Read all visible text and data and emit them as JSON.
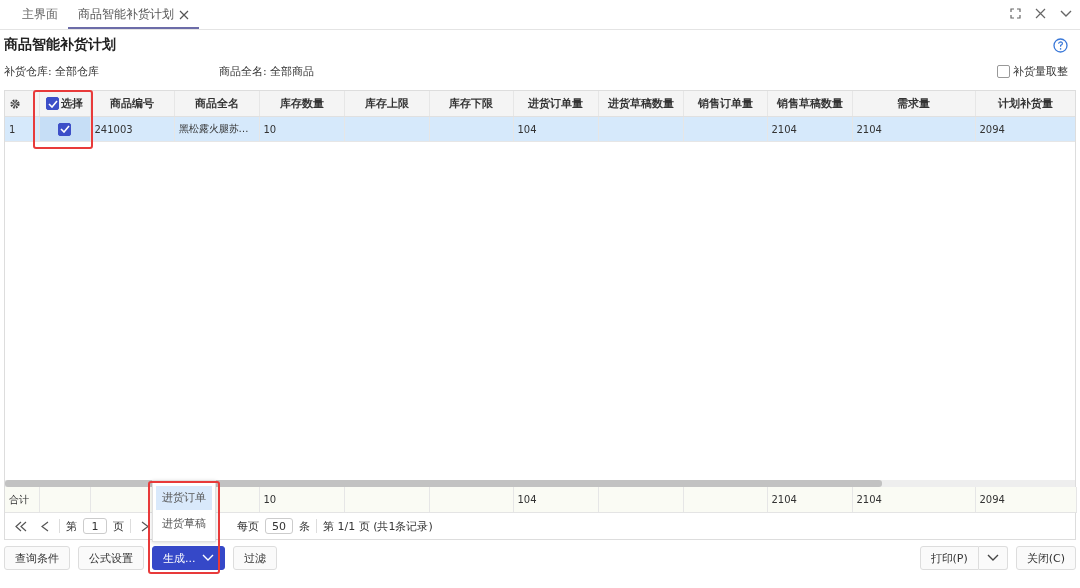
{
  "tabs": [
    {
      "label": "主界面",
      "selected": false,
      "closable": false
    },
    {
      "label": "商品智能补货计划",
      "selected": true,
      "closable": true
    }
  ],
  "title": "商品智能补货计划",
  "filters": [
    {
      "label": "补货仓库:",
      "value": "全部仓库"
    },
    {
      "label": "商品全名:",
      "value": "全部商品"
    }
  ],
  "round_option": {
    "label": "补货量取整",
    "checked": false
  },
  "table": {
    "select_column": {
      "label": "选择",
      "checked": true
    },
    "columns": [
      "商品编号",
      "商品全名",
      "库存数量",
      "库存上限",
      "库存下限",
      "进货订单量",
      "进货草稿数量",
      "销售订单量",
      "销售草稿数量",
      "需求量",
      "计划补货量"
    ],
    "rows": [
      {
        "number": "1",
        "checked": true,
        "selected": true,
        "cells": [
          "241003",
          "黑松露火腿苏…",
          "10",
          null,
          null,
          "104",
          null,
          null,
          "2104",
          "2104",
          "2094"
        ]
      }
    ],
    "totals": {
      "label": "合计",
      "cells": [
        null,
        null,
        "10",
        null,
        null,
        "104",
        null,
        null,
        "2104",
        "2104",
        "2094"
      ]
    }
  },
  "pager": {
    "page_prefix": "第",
    "page": "1",
    "page_suffix": "页",
    "per_page_label": "每页",
    "per_page": "50",
    "per_page_unit": "条",
    "summary": "第 1/1 页 (共1条记录)"
  },
  "buttons": [
    {
      "label": "查询条件",
      "kind": "plain"
    },
    {
      "label": "公式设置",
      "kind": "plain"
    },
    {
      "label": "生成...",
      "kind": "menu"
    },
    {
      "label": "过滤",
      "kind": "plain"
    }
  ],
  "generate_menu": [
    {
      "label": "进货订单",
      "selected": true
    },
    {
      "label": "进货草稿",
      "selected": false
    }
  ],
  "right_buttons": [
    {
      "label": "打印(P)",
      "kind": "split"
    },
    {
      "label": "关闭(C)",
      "kind": "plain"
    }
  ]
}
